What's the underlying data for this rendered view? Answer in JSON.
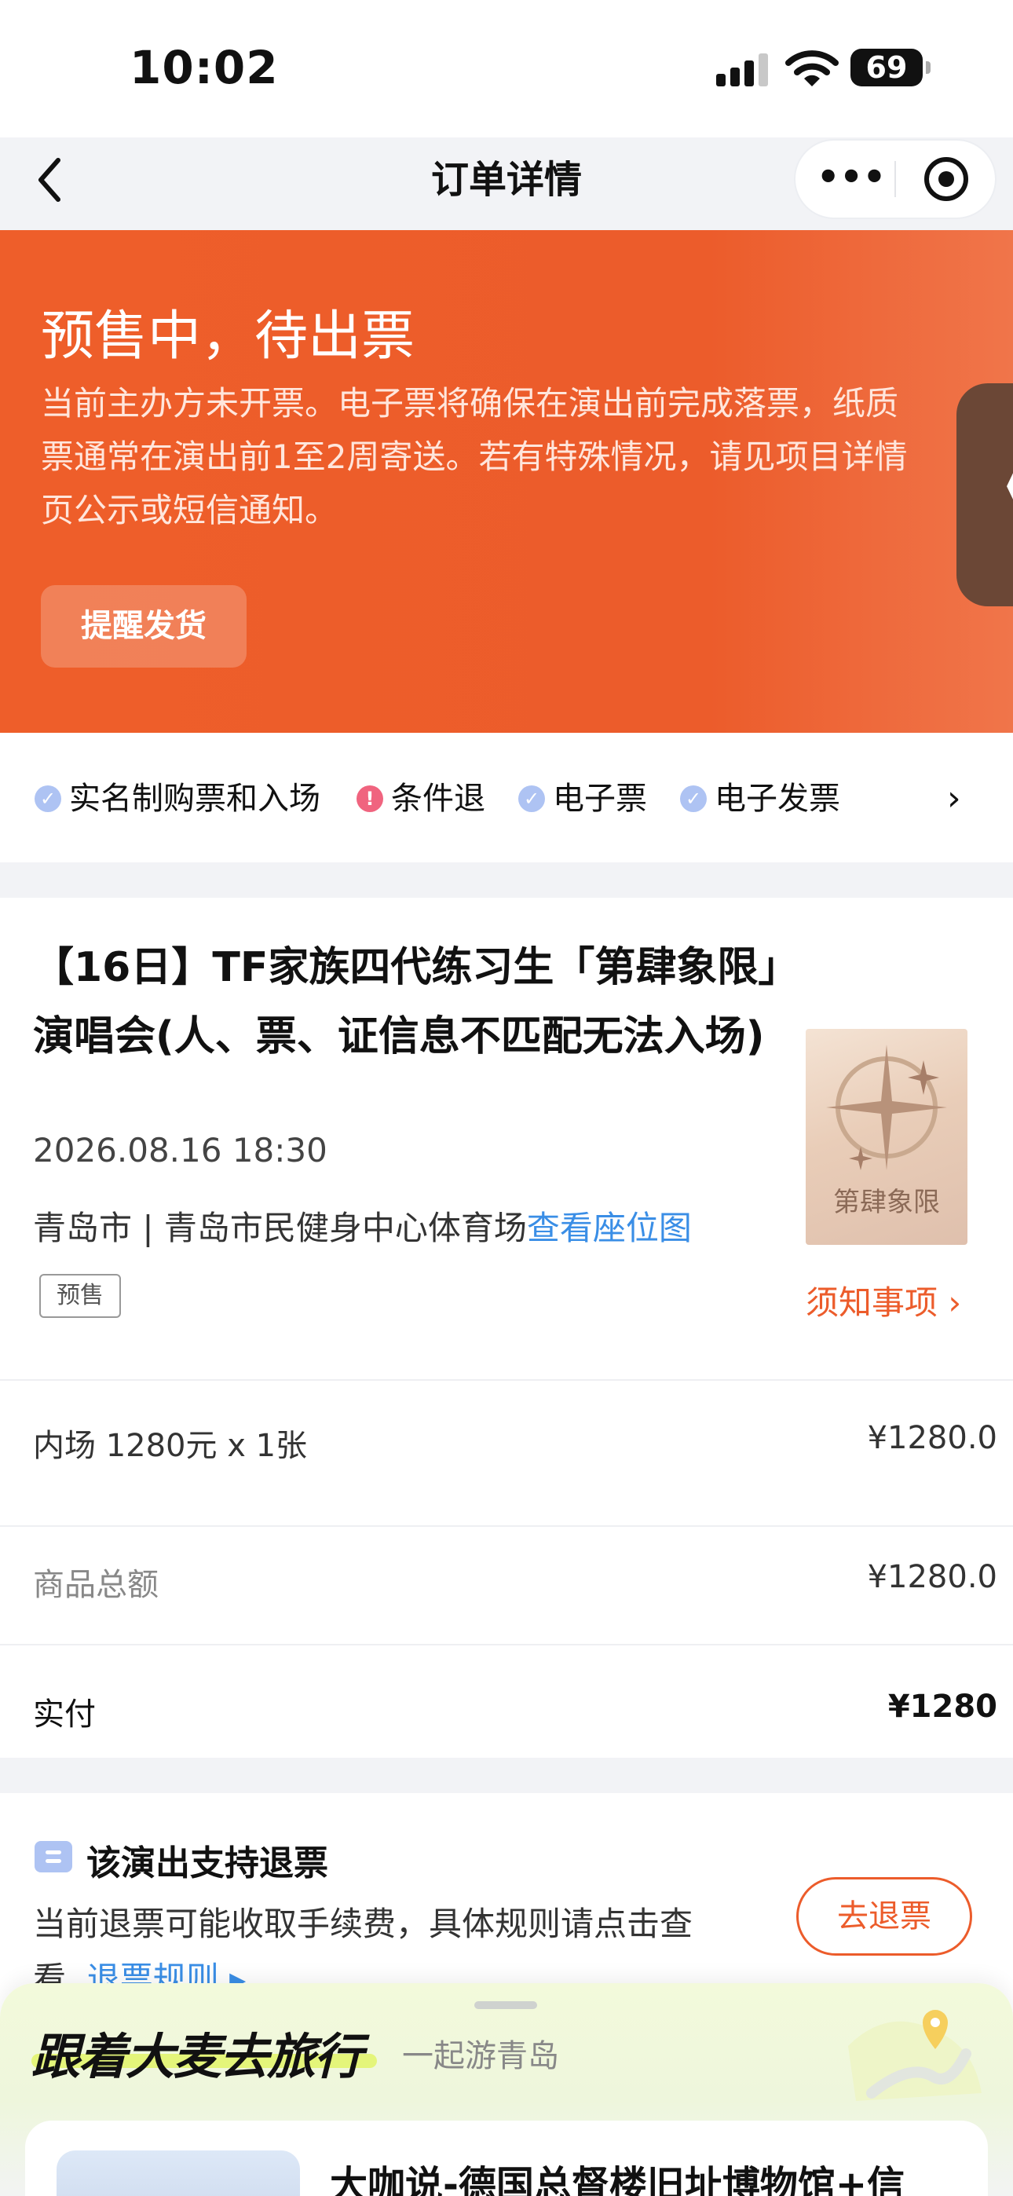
{
  "status_bar": {
    "time": "10:02",
    "battery": "69"
  },
  "nav": {
    "title": "订单详情"
  },
  "banner": {
    "title": "预售中，待出票",
    "description": "当前主办方未开票。电子票将确保在演出前完成落票，纸质票通常在演出前1至2周寄送。若有特殊情况，请见项目详情页公示或短信通知。",
    "remind_button": "提醒发货",
    "side_handle": "《"
  },
  "tags": [
    {
      "label": "实名制购票和入场",
      "icon": "check-icon",
      "color": "#aec3f3"
    },
    {
      "label": "条件退",
      "icon": "exclamation-icon",
      "color": "#f0647f"
    },
    {
      "label": "电子票",
      "icon": "check-icon",
      "color": "#aec3f3"
    },
    {
      "label": "电子发票",
      "icon": "check-icon",
      "color": "#aec3f3"
    }
  ],
  "show": {
    "title": "【16日】TF家族四代练习生「第肆象限」演唱会(人、票、证信息不匹配无法入场)",
    "datetime": "2026.08.16 18:30",
    "venue": "青岛市 | 青岛市民健身中心体育场",
    "seat_map_link": "查看座位图",
    "presale_badge": "预售",
    "notice_link": "须知事项",
    "poster_text": "第肆象限"
  },
  "order": {
    "ticket_line": "内场 1280元 x 1张",
    "ticket_price": "¥1280.0",
    "subtotal_label": "商品总额",
    "subtotal_value": "¥1280.0",
    "paid_label": "实付",
    "paid_value": "¥1280"
  },
  "refund": {
    "title": "该演出支持退票",
    "description": "当前退票可能收取手续费，具体规则请点击查看",
    "rules_link": "退票规则",
    "button": "去退票"
  },
  "travel": {
    "title": "跟着大麦去旅行",
    "subtitle": "一起游青岛",
    "card_title": "大咖说-德国总督楼旧址博物馆+信"
  },
  "colors": {
    "accent_orange": "#ec5c2b",
    "link_blue": "#3a8ee6",
    "highlight_green": "#e4f57a"
  }
}
